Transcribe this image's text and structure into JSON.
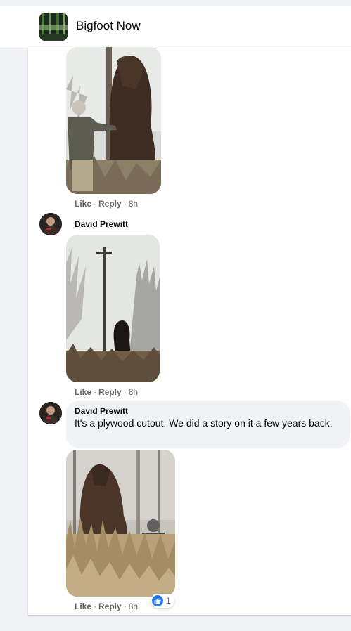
{
  "header": {
    "group_name": "Bigfoot Now"
  },
  "comments": [
    {
      "actions": {
        "like": "Like",
        "reply": "Reply",
        "time": "8h"
      }
    },
    {
      "author": "David Prewitt",
      "actions": {
        "like": "Like",
        "reply": "Reply",
        "time": "8h"
      }
    },
    {
      "author": "David Prewitt",
      "text": "It's a plywood cutout. We did a story on it a few years back.",
      "actions": {
        "like": "Like",
        "reply": "Reply",
        "time": "8h"
      },
      "reactions": {
        "icon": "thumbs-up-icon",
        "count": "1"
      }
    }
  ],
  "colors": {
    "like_blue": "#1877f2",
    "meta_gray": "#65676b",
    "bubble_bg": "#f0f2f5"
  }
}
